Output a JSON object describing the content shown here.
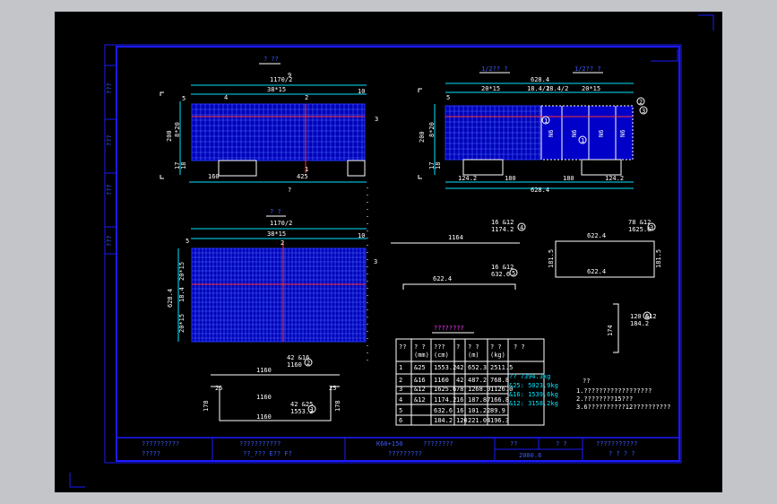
{
  "colors": {
    "app_background": "#c3c5c9",
    "canvas": "#000000",
    "frame": "#1a1aff",
    "dimension": "#00e5ff",
    "text": "#ffffff",
    "callout": "#ffff00",
    "rebar": "#ff3333"
  },
  "drawing": {
    "side_labels": [
      "???",
      "???",
      "???",
      "???"
    ],
    "top_elevation": {
      "heading": "? ??",
      "dims": {
        "top_total": "1170/2",
        "top_split": "38*15",
        "left_small": "5",
        "left_height": "200",
        "left_segments": [
          "8*20",
          "17",
          "18"
        ],
        "right_small": "10",
        "bottom_a": "160",
        "bottom_b": "425",
        "top_mark": "9"
      },
      "markers": [
        "4",
        "2",
        "3",
        "1"
      ],
      "caption": "?"
    },
    "right_elevation": {
      "heading_left": "1/2?? ?",
      "heading_right": "1/2?? ?",
      "dims": {
        "top_total": "628.4",
        "top_a": "5",
        "top_b": "20*15",
        "top_c": "18.4/2",
        "top_d": "18.4/2",
        "top_e": "20*15",
        "left_height": "200",
        "left_segments": [
          "8*20",
          "17",
          "18"
        ],
        "bottom_a": "124.2",
        "bottom_b": "180",
        "bottom_c": "180",
        "bottom_d": "124.2",
        "bottom_total": "628.4"
      },
      "markers": [
        "1",
        "2",
        "3"
      ],
      "bar_tags": [
        "N6",
        "N6",
        "N6",
        "N6"
      ]
    },
    "plan_view": {
      "heading": "? ?",
      "dims": {
        "top_total": "1170/2",
        "top_split": "38*15",
        "left_total": "628.4",
        "left_segments": [
          "20*15",
          "18.4",
          "20*15"
        ],
        "right_small": "10",
        "left_small": "5"
      },
      "markers": [
        "2",
        "3"
      ]
    },
    "bar_shapes": [
      {
        "callout": "16 &12",
        "length_label": "1174.2",
        "marker": "4",
        "dim": "1164"
      },
      {
        "callout": "16 &12",
        "length_label": "632.6",
        "marker": "5",
        "dim": "622.4"
      },
      {
        "callout": "78 &12",
        "length_label": "1625.6",
        "marker": "3",
        "dims": [
          "622.4",
          "181.5",
          "181.5",
          "622.4"
        ]
      },
      {
        "callout": "120 &12",
        "length_label": "184.2",
        "marker": "6",
        "dim": "174"
      },
      {
        "callout": "42 &16",
        "length_label": "1160",
        "marker": "2",
        "dim": "1160"
      },
      {
        "callout": "42 &25",
        "length_label": "1553.2",
        "marker": "1",
        "dims": [
          "1160",
          "25",
          "25",
          "178",
          "178",
          "1160"
        ]
      }
    ],
    "rebar_table": {
      "title": "????????",
      "headers": [
        "??",
        "? ?\n(mm)",
        "???\n(cm)",
        "?",
        "? ?\n(m)",
        "? ?\n(kg)",
        "? ?"
      ],
      "rows": [
        [
          "1",
          "&25",
          "1553.2",
          "42",
          "652.3",
          "2511.5"
        ],
        [
          "2",
          "&16",
          "1160",
          "42",
          "487.2",
          "768.8"
        ],
        [
          "3",
          "&12",
          "1625.6",
          "78",
          "1268.0",
          "1126.0"
        ],
        [
          "4",
          "&12",
          "1174.2",
          "16",
          "187.87",
          "166.8"
        ],
        [
          "5",
          "",
          "632.6",
          "16",
          "101.22",
          "89.9"
        ],
        [
          "6",
          "",
          "184.2",
          "120",
          "221.04",
          "196.3"
        ]
      ],
      "totals": [
        "?? 7394.3kg",
        "&25: 5023.9kg",
        "&16: 1539.6kg",
        "&12: 3158.2kg"
      ]
    },
    "notes": {
      "title": "??",
      "lines": [
        "1.??????????????????",
        "2.????????15???",
        "3.6??????????12??????????"
      ]
    },
    "title_block": {
      "cell1": [
        "??????????",
        "?????"
      ],
      "cell2": [
        "???????????",
        "??_??? E?? F?"
      ],
      "cell3": [
        "K60+150",
        "????????",
        "?????????"
      ],
      "cell4": [
        "??",
        "? ?",
        "2000.6"
      ],
      "cell5": [
        "???????????",
        "? ? ? ?"
      ]
    }
  }
}
